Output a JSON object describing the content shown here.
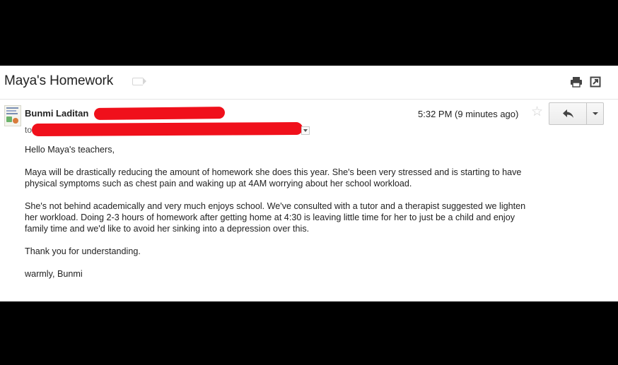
{
  "email": {
    "subject": "Maya's Homework",
    "sender_name": "Bunmi Laditan",
    "to_label": "to",
    "timestamp": "5:32 PM (9 minutes ago)",
    "greeting": "Hello Maya's teachers,",
    "paragraph_1": "Maya will be drastically reducing the amount of homework she does this year. She's been very stressed and is starting to have\nphysical symptoms such as chest pain and waking up at 4AM worrying about her school workload.",
    "paragraph_2": "She's not behind academically and very much enjoys school. We've consulted with a tutor and a therapist suggested we lighten\nher workload. Doing 2-3 hours of homework after getting home at 4:30 is leaving little time for her to just be a child and enjoy\nfamily time and we'd like to avoid her sinking into a depression over this.",
    "paragraph_3": "Thank you for understanding.",
    "signoff": "warmly, Bunmi"
  },
  "icons": {
    "label": "label-icon",
    "print": "print-icon",
    "popout": "open-in-new-window-icon",
    "star": "star-icon",
    "reply": "reply-icon",
    "more": "chevron-down-icon",
    "to_details": "chevron-down-icon"
  },
  "colors": {
    "redaction": "#f0101b",
    "background_outer": "#000000",
    "panel": "#ffffff"
  }
}
